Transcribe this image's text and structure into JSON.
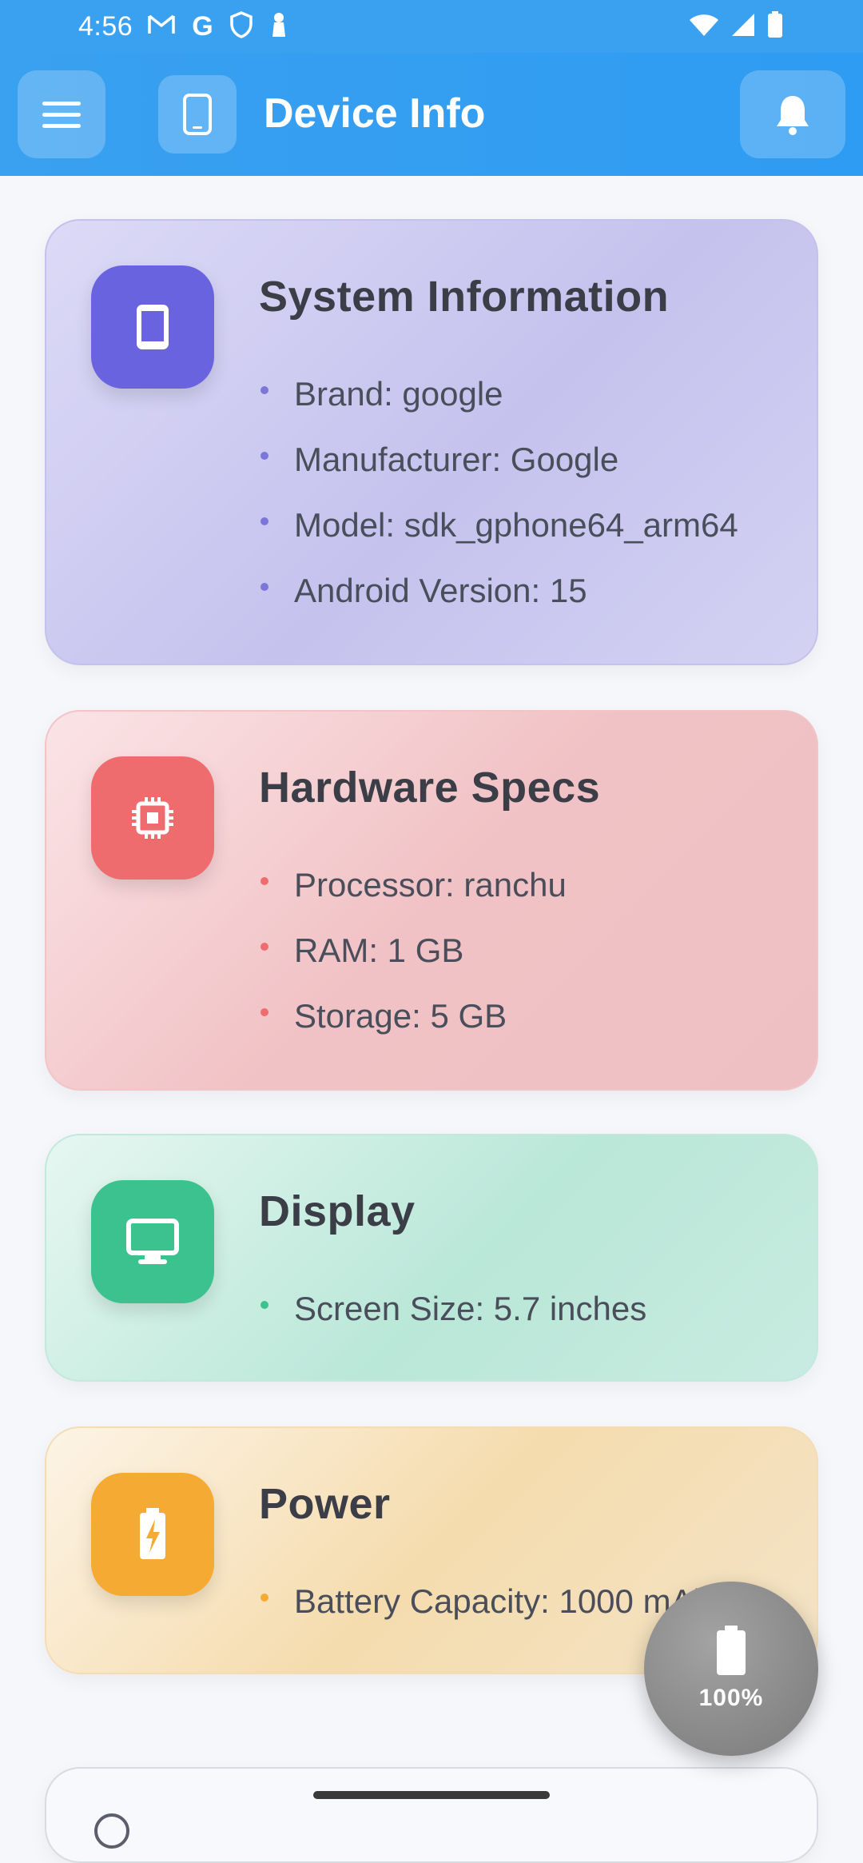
{
  "status_bar": {
    "time": "4:56",
    "left_icons": [
      "gmail-icon",
      "google-icon",
      "shield-icon",
      "keyhole-icon"
    ],
    "right_icons": [
      "wifi-icon",
      "signal-icon",
      "battery-icon"
    ]
  },
  "app_bar": {
    "title": "Device Info",
    "accent_color": "#3aa0f0"
  },
  "cards": {
    "system": {
      "title": "System Information",
      "icon": "phone-icon",
      "color": "#6a63df",
      "dot_color": "#7c76d8",
      "items": [
        "Brand: google",
        "Manufacturer: Google",
        "Model: sdk_gphone64_arm64",
        "Android Version: 15"
      ]
    },
    "hardware": {
      "title": "Hardware Specs",
      "icon": "chip-icon",
      "color": "#ee6b6e",
      "dot_color": "#ee6b6e",
      "items": [
        "Processor: ranchu",
        "RAM: 1 GB",
        "Storage: 5 GB"
      ]
    },
    "display": {
      "title": "Display",
      "icon": "monitor-icon",
      "color": "#3cc28e",
      "dot_color": "#3cc28e",
      "items": [
        "Screen Size: 5.7 inches"
      ]
    },
    "power": {
      "title": "Power",
      "icon": "battery-bolt-icon",
      "color": "#f4aa33",
      "dot_color": "#f4aa33",
      "items": [
        "Battery Capacity: 1000 mAh"
      ]
    }
  },
  "fab": {
    "label": "100%",
    "icon": "battery-full-icon"
  }
}
